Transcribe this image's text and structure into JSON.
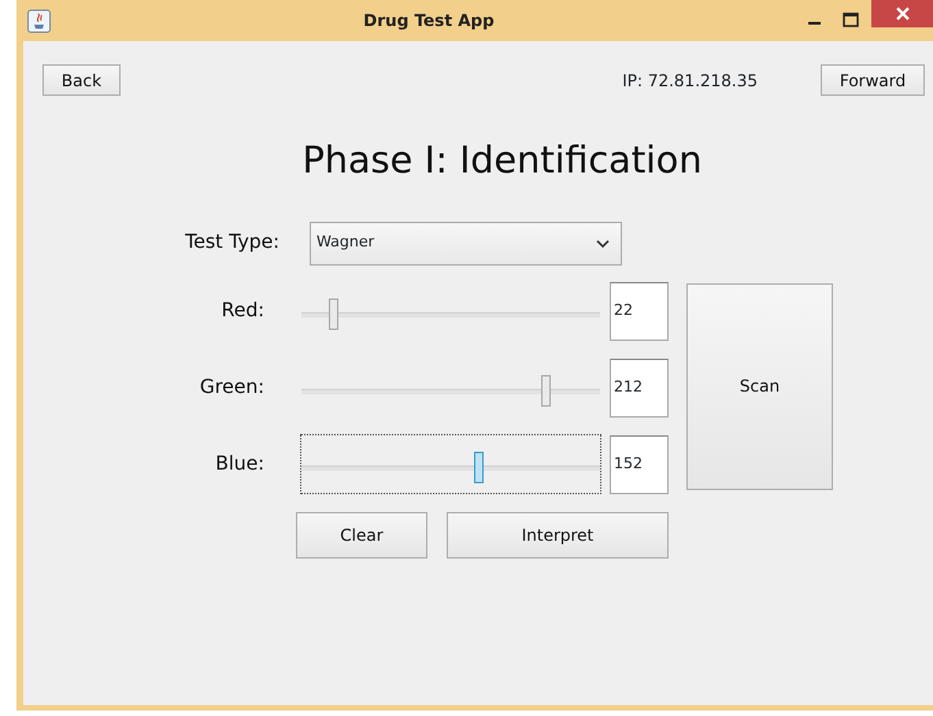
{
  "window": {
    "title": "Drug Test App"
  },
  "nav": {
    "back": "Back",
    "ip": "IP: 72.81.218.35",
    "forward": "Forward"
  },
  "heading": "Phase I: Identification",
  "test_type": {
    "label": "Test Type:",
    "value": "Wagner"
  },
  "channels": [
    {
      "name": "Red:",
      "level": 0.086,
      "reading": "22",
      "focused": false
    },
    {
      "name": "Green:",
      "level": 0.831,
      "reading": "212",
      "focused": false
    },
    {
      "name": "Blue:",
      "level": 0.596,
      "reading": "152",
      "focused": true
    }
  ],
  "buttons": {
    "scan": "Scan",
    "clear": "Clear",
    "interpret": "Interpret"
  }
}
